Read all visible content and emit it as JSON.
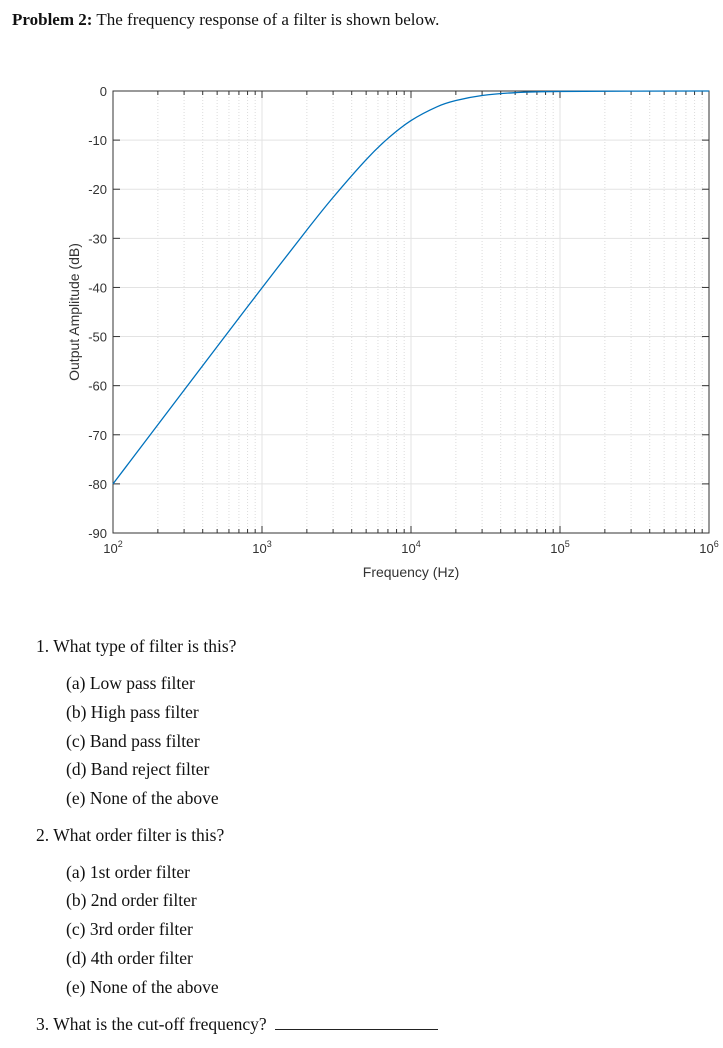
{
  "problem": {
    "label": "Problem 2:",
    "text": "The frequency response of a filter is shown below."
  },
  "chart_data": {
    "type": "line",
    "title": "",
    "xlabel": "Frequency (Hz)",
    "ylabel": "Output Amplitude (dB)",
    "xscale": "log",
    "xlim": [
      100,
      1000000
    ],
    "ylim": [
      -90,
      0
    ],
    "x_ticks": [
      "10^2",
      "10^3",
      "10^4",
      "10^5",
      "10^6"
    ],
    "y_ticks": [
      "0",
      "-10",
      "-20",
      "-30",
      "-40",
      "-50",
      "-60",
      "-70",
      "-80",
      "-90"
    ],
    "grid": true,
    "line_color": "#0072bd",
    "x": [
      100,
      200,
      500,
      1000,
      2000,
      3000,
      5000,
      7000,
      10000,
      15000,
      20000,
      30000,
      50000,
      100000,
      1000000
    ],
    "y": [
      -80.0,
      -67.96,
      -52.05,
      -40.09,
      -28.3,
      -21.66,
      -13.98,
      -9.66,
      -6.02,
      -3.19,
      -1.94,
      -0.92,
      -0.34,
      -0.09,
      0
    ]
  },
  "questions": [
    {
      "number": "1.",
      "text": "What type of filter is this?",
      "options": [
        {
          "letter": "(a)",
          "text": "Low pass filter"
        },
        {
          "letter": "(b)",
          "text": "High pass filter"
        },
        {
          "letter": "(c)",
          "text": "Band pass filter"
        },
        {
          "letter": "(d)",
          "text": "Band reject filter"
        },
        {
          "letter": "(e)",
          "text": "None of the above"
        }
      ]
    },
    {
      "number": "2.",
      "text": "What order filter is this?",
      "options": [
        {
          "letter": "(a)",
          "text": "1st order filter"
        },
        {
          "letter": "(b)",
          "text": "2nd order filter"
        },
        {
          "letter": "(c)",
          "text": "3rd order filter"
        },
        {
          "letter": "(d)",
          "text": "4th order filter"
        },
        {
          "letter": "(e)",
          "text": "None of the above"
        }
      ]
    },
    {
      "number": "3.",
      "text": "What is the cut-off frequency?"
    }
  ]
}
